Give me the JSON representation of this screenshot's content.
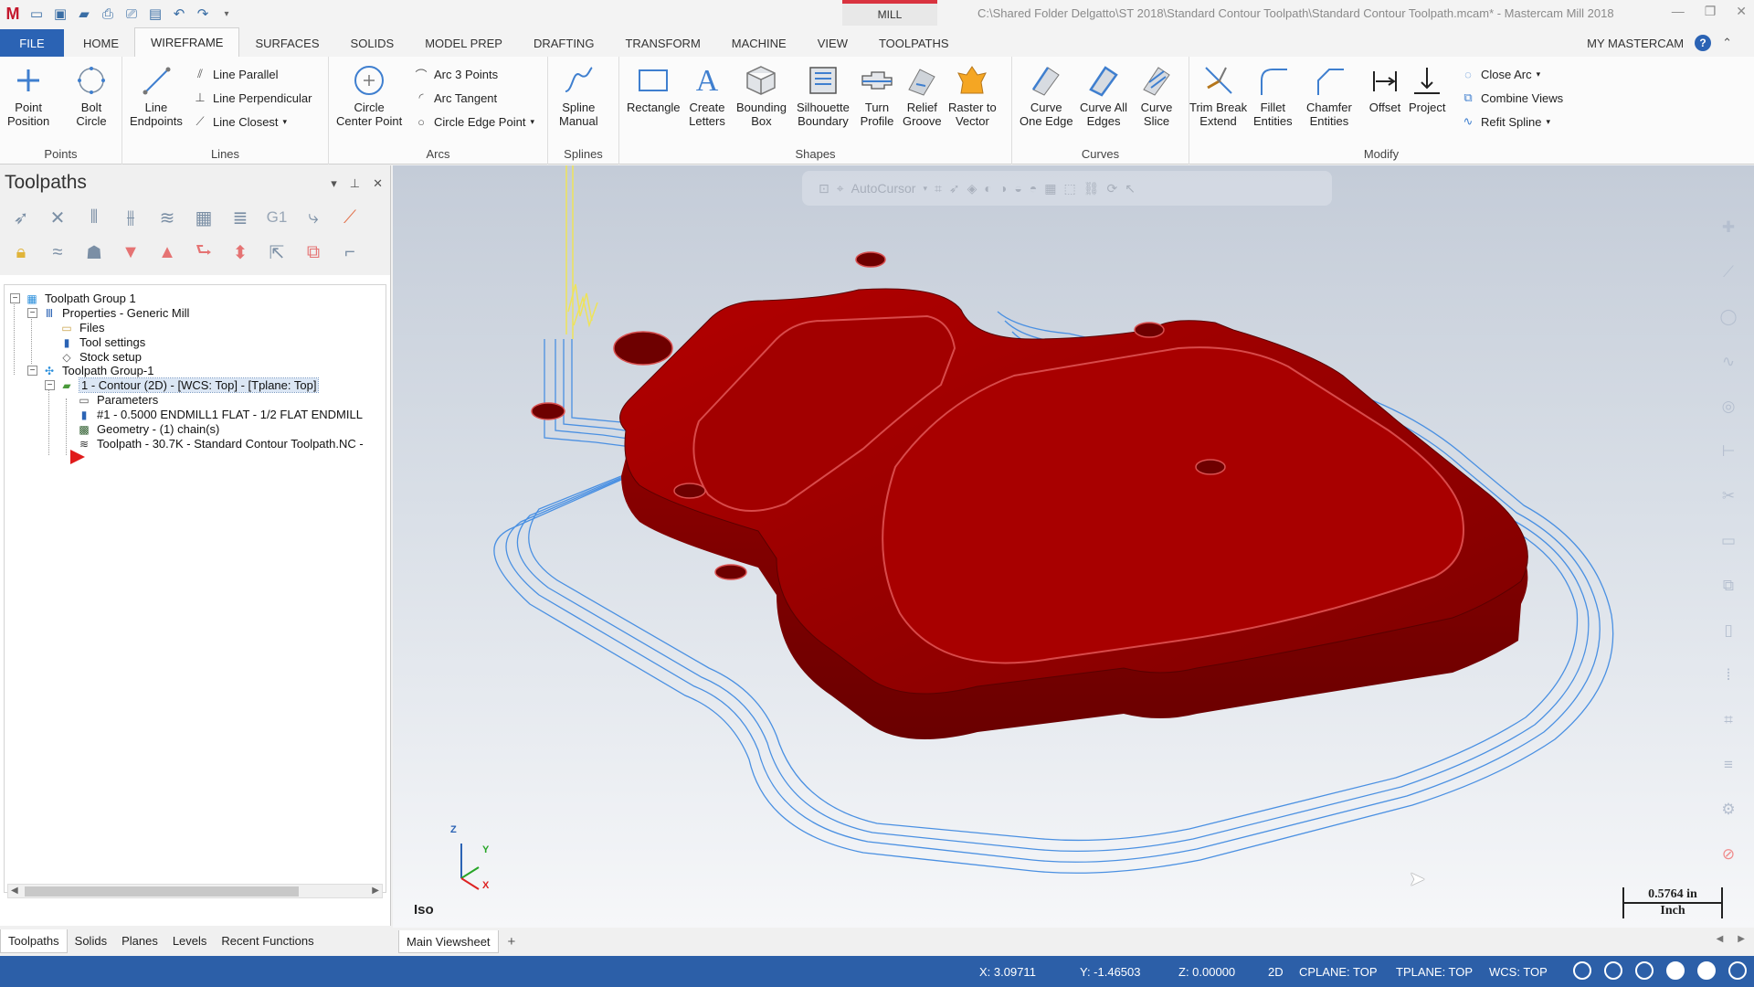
{
  "window": {
    "mill_tab": "MILL",
    "title": "C:\\Shared Folder Delgatto\\ST 2018\\Standard Contour Toolpath\\Standard Contour Toolpath.mcam* - Mastercam Mill 2018"
  },
  "tabs": [
    "FILE",
    "HOME",
    "WIREFRAME",
    "SURFACES",
    "SOLIDS",
    "MODEL PREP",
    "DRAFTING",
    "TRANSFORM",
    "MACHINE",
    "VIEW",
    "TOOLPATHS"
  ],
  "tabs_right": {
    "label": "MY MASTERCAM",
    "help": "?"
  },
  "ribbon": {
    "points": {
      "label": "Points",
      "point_position": "Point\nPosition",
      "bolt_circle": "Bolt\nCircle"
    },
    "lines": {
      "label": "Lines",
      "line_endpoints": "Line\nEndpoints",
      "line_parallel": "Line Parallel",
      "line_perpendicular": "Line Perpendicular",
      "line_closest": "Line Closest"
    },
    "arcs": {
      "label": "Arcs",
      "circle_center_point": "Circle\nCenter Point",
      "arc_3_points": "Arc 3 Points",
      "arc_tangent": "Arc Tangent",
      "circle_edge_point": "Circle Edge Point"
    },
    "splines": {
      "label": "Splines",
      "spline_manual": "Spline\nManual"
    },
    "shapes": {
      "label": "Shapes",
      "rectangle": "Rectangle",
      "create_letters": "Create\nLetters",
      "bounding_box": "Bounding\nBox",
      "silhouette_boundary": "Silhouette\nBoundary",
      "turn_profile": "Turn\nProfile",
      "relief_groove": "Relief\nGroove",
      "raster_to_vector": "Raster to\nVector"
    },
    "curves": {
      "label": "Curves",
      "curve_one_edge": "Curve\nOne Edge",
      "curve_all_edges": "Curve All\nEdges",
      "curve_slice": "Curve\nSlice"
    },
    "modify": {
      "label": "Modify",
      "trim_break_extend": "Trim Break\nExtend",
      "fillet_entities": "Fillet\nEntities",
      "chamfer_entities": "Chamfer\nEntities",
      "offset": "Offset",
      "project": "Project",
      "close_arc": "Close Arc",
      "combine_views": "Combine Views",
      "refit_spline": "Refit Spline"
    }
  },
  "panel": {
    "title": "Toolpaths",
    "toolbar_g1": "G1",
    "tree": {
      "group1": "Toolpath Group 1",
      "properties": "Properties - Generic Mill",
      "files": "Files",
      "tool_settings": "Tool settings",
      "stock_setup": "Stock setup",
      "group1b": "Toolpath Group-1",
      "contour": "1 - Contour (2D) - [WCS: Top] - [Tplane: Top]",
      "parameters": "Parameters",
      "tool": "#1 - 0.5000 ENDMILL1 FLAT -  1/2 FLAT ENDMILL",
      "geometry": "Geometry - (1) chain(s)",
      "toolpath": "Toolpath - 30.7K - Standard Contour Toolpath.NC -"
    }
  },
  "bottom_tabs": [
    "Toolpaths",
    "Solids",
    "Planes",
    "Levels",
    "Recent Functions"
  ],
  "viewport": {
    "autocursor": "AutoCursor",
    "view_label": "Iso",
    "scale_value": "0.5764 in",
    "scale_unit": "Inch",
    "axis_z": "Z",
    "axis_y": "Y",
    "axis_x": "X"
  },
  "sheet": {
    "name": "Main Viewsheet",
    "add": "+"
  },
  "status": {
    "x": "X:   3.09711",
    "y": "Y:   -1.46503",
    "z": "Z:   0.00000",
    "mode": "2D",
    "cplane": "CPLANE: TOP",
    "tplane": "TPLANE: TOP",
    "wcs": "WCS: TOP"
  },
  "colors": {
    "accent": "#2b63b4",
    "status_bar": "#2c5fa8",
    "part": "#b00000",
    "toolpath": "#4a90e2",
    "tool_motion": "#f2e34a",
    "mill_tab": "#d9333f"
  }
}
